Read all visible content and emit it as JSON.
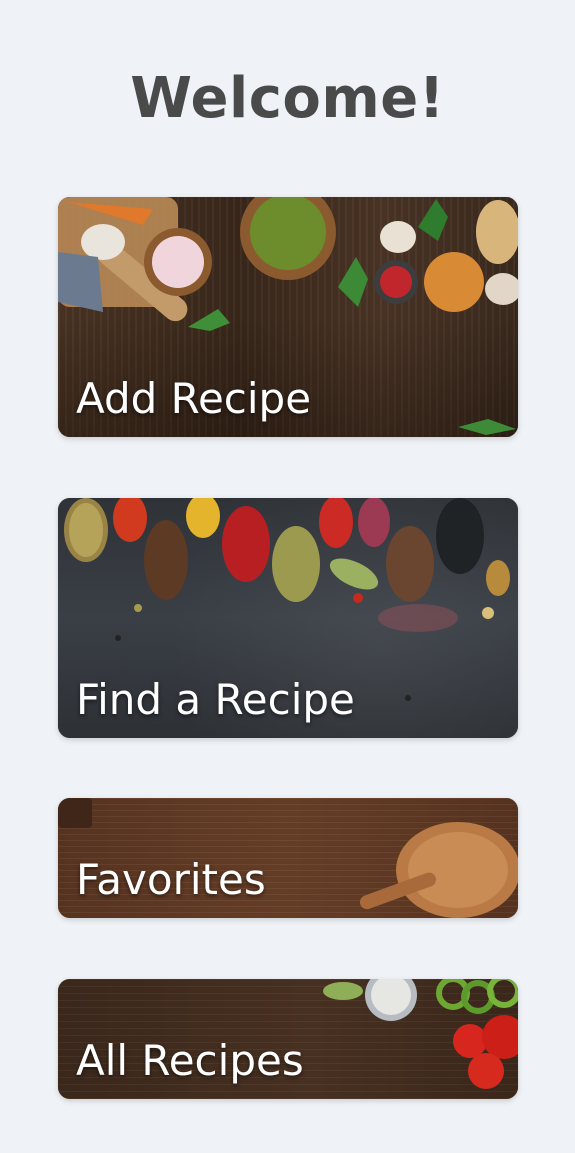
{
  "header": {
    "title": "Welcome!"
  },
  "cards": [
    {
      "label": "Add Recipe",
      "image": "wooden-board-ingredients"
    },
    {
      "label": "Find a Recipe",
      "image": "spices-on-slate"
    },
    {
      "label": "Favorites",
      "image": "wooden-spoon-on-wood"
    },
    {
      "label": "All Recipes",
      "image": "vegetables-on-wood"
    }
  ],
  "colors": {
    "background": "#eff2f6",
    "title_text": "#4a4a4a",
    "card_label": "#ffffff"
  }
}
